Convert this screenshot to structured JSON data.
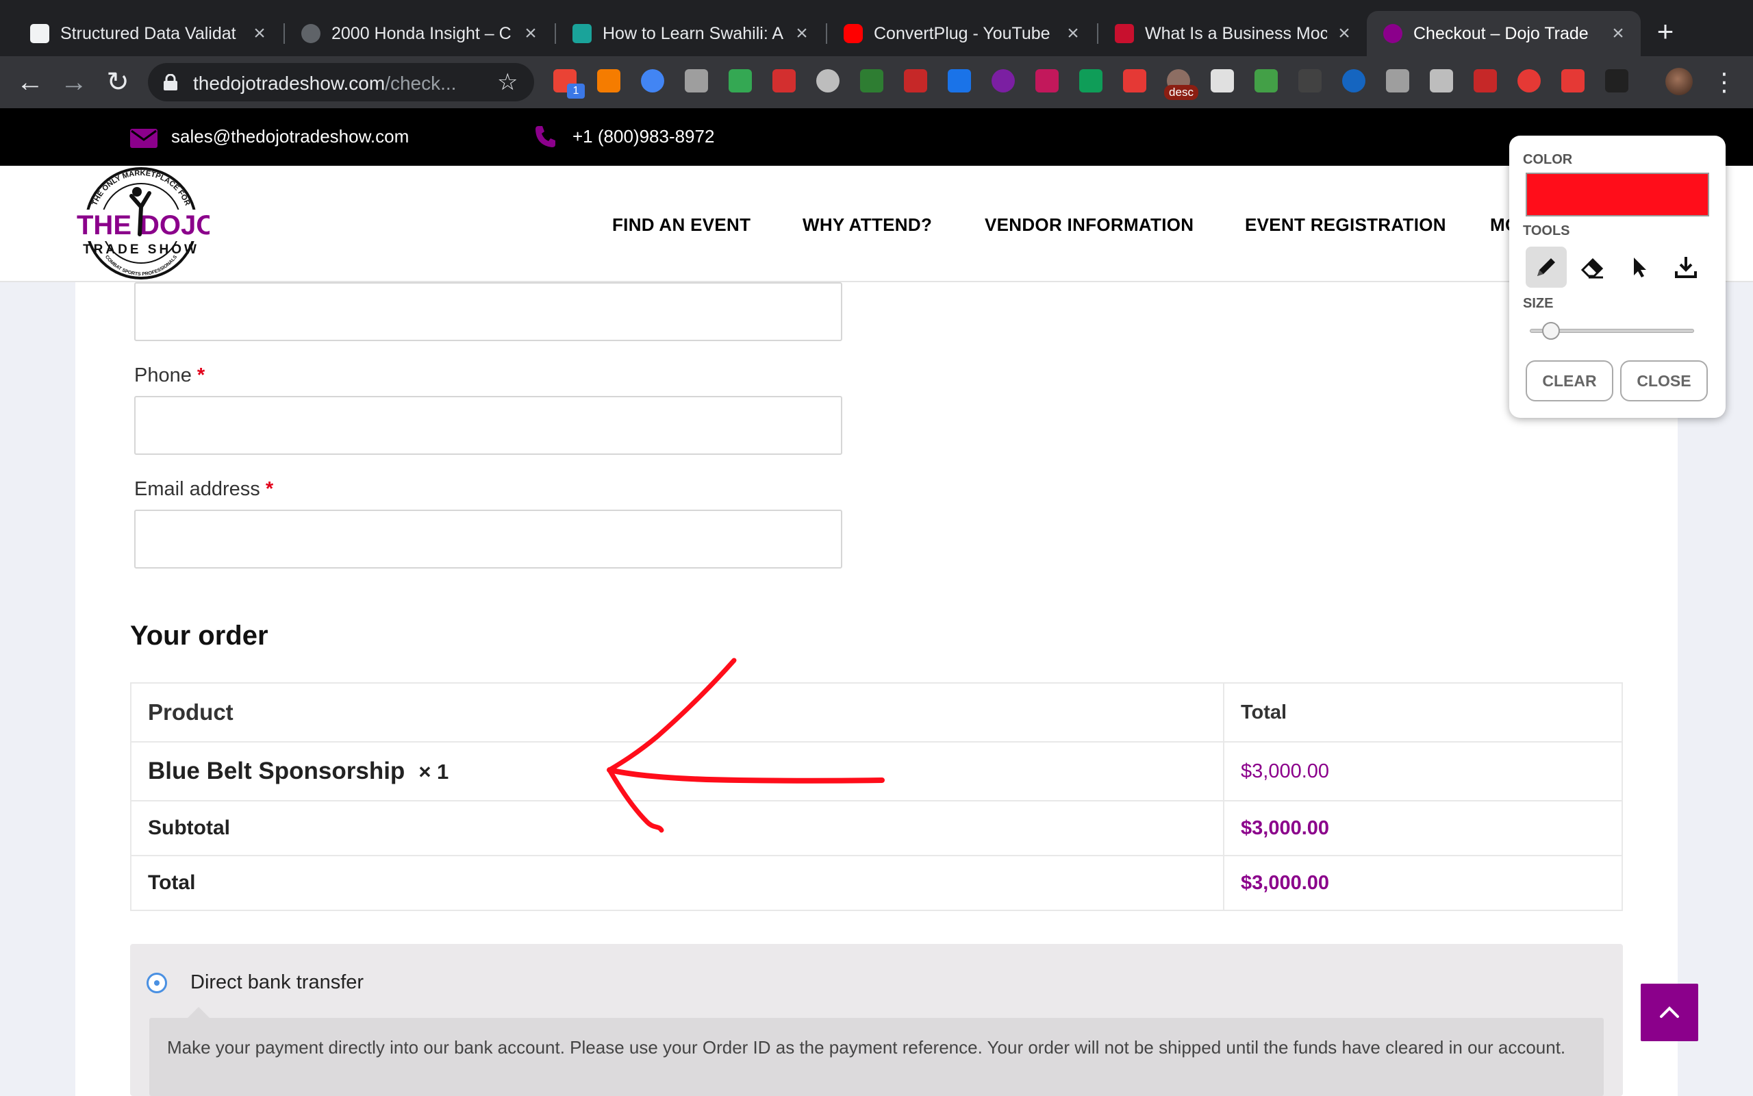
{
  "browser": {
    "tabs": [
      {
        "title": "Structured Data Validat",
        "favicon_color": "#f1f3f4",
        "active": false
      },
      {
        "title": "2000 Honda Insight – C",
        "favicon_color": "#9aa0a6",
        "active": false
      },
      {
        "title": "How to Learn Swahili: A",
        "favicon_color": "#1aa39a",
        "active": false
      },
      {
        "title": "ConvertPlug - YouTube",
        "favicon_color": "#ff0000",
        "active": false
      },
      {
        "title": "What Is a Business Moc",
        "favicon_color": "#c8102e",
        "active": false
      },
      {
        "title": "Checkout – Dojo Trade",
        "favicon_color": "#8b008b",
        "active": true
      }
    ],
    "url_host": "thedojotradeshow.com",
    "url_path": "/check...",
    "extension_badge": "1",
    "extension_desc_label": "desc",
    "extension_colors": [
      "#ea4335",
      "#f57c00",
      "#4285f4",
      "#9e9e9e",
      "#34a853",
      "#d32f2f",
      "#bdbdbd",
      "#2e7d32",
      "#c62828",
      "#1a73e8",
      "#7b1fa2",
      "#c2185b",
      "#0f9d58",
      "#e53935",
      "#8d6e63",
      "#e0e0e0",
      "#43a047",
      "#424242",
      "#1565c0",
      "#9e9e9e",
      "#bdbdbd",
      "#c62828",
      "#e53935",
      "#e53935",
      "#212121"
    ]
  },
  "topbar": {
    "email": "sales@thedojotradeshow.com",
    "phone": "+1 (800)983-8972",
    "accent_color": "#8b008b"
  },
  "logo": {
    "arc_text": "THE ONLY MARKETPLACE FOR",
    "title_left": "THE",
    "title_right": "DOJO",
    "subtitle": "TRADE SHOW",
    "bottom_text": "COMBAT SPORTS PROFESSIONALS"
  },
  "nav": {
    "items": [
      "FIND AN EVENT",
      "WHY ATTEND?",
      "VENDOR INFORMATION",
      "EVENT REGISTRATION",
      "MO"
    ]
  },
  "form": {
    "phone_label": "Phone",
    "email_label": "Email address",
    "required_mark": "*"
  },
  "order": {
    "heading": "Your order",
    "columns": {
      "product": "Product",
      "total": "Total"
    },
    "item_name": "Blue Belt Sponsorship",
    "item_qty": "× 1",
    "item_total": "$3,000.00",
    "subtotal_label": "Subtotal",
    "subtotal_value": "$3,000.00",
    "total_label": "Total",
    "total_value": "$3,000.00"
  },
  "payment": {
    "method": "Direct bank transfer",
    "description": "Make your payment directly into our bank account. Please use your Order ID as the payment reference. Your order will not be shipped until the funds have cleared in our account."
  },
  "draw_panel": {
    "color_label": "COLOR",
    "tools_label": "TOOLS",
    "size_label": "SIZE",
    "clear_label": "CLEAR",
    "close_label": "CLOSE",
    "color_value": "#ff0d1a",
    "selected_tool": "pencil",
    "size_fraction": 0.1
  }
}
